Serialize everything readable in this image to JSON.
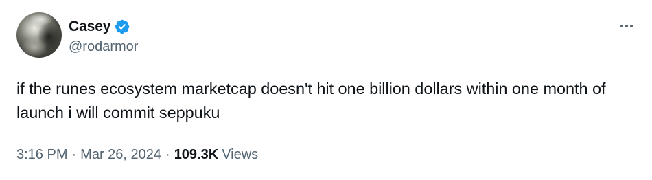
{
  "author": {
    "display_name": "Casey",
    "handle": "@rodarmor",
    "verified": true,
    "verified_color": "#1d9bf0"
  },
  "tweet": {
    "text": "if the runes ecosystem marketcap doesn't hit one billion dollars within one month of launch i will commit seppuku",
    "time": "3:16 PM",
    "separator": "·",
    "date": "Mar 26, 2024",
    "views_count": "109.3K",
    "views_label": "Views"
  },
  "icons": {
    "avatar": "profile-photo",
    "verified": "verified-badge-icon",
    "more": "more-options-icon"
  },
  "colors": {
    "text_primary": "#0f1419",
    "text_secondary": "#536471",
    "background": "#ffffff"
  }
}
